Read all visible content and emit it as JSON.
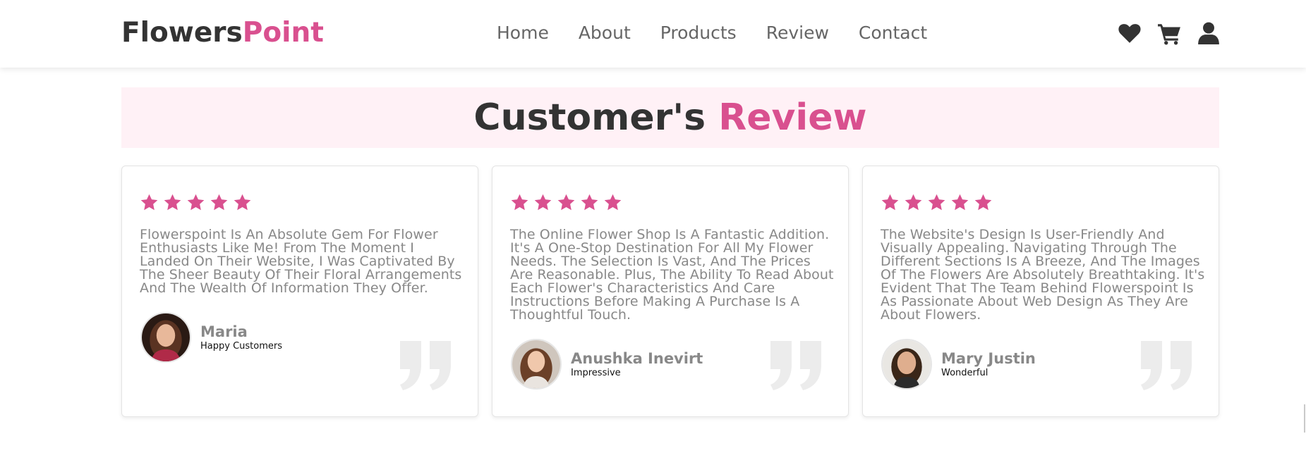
{
  "header": {
    "logo_primary": "Flowers",
    "logo_accent": "Point",
    "nav": [
      "Home",
      "About",
      "Products",
      "Review",
      "Contact"
    ],
    "icons": [
      "heart-icon",
      "cart-icon",
      "user-icon"
    ]
  },
  "section": {
    "title_primary": "Customer's",
    "title_accent": "Review"
  },
  "colors": {
    "accent": "#d9508f",
    "heading_band": "#fff1f6",
    "text_dark": "#333333",
    "text_muted": "#888888"
  },
  "reviews": [
    {
      "rating": 5,
      "text": "Flowerspoint Is An Absolute Gem For Flower Enthusiasts Like Me! From The Moment I Landed On Their Website, I Was Captivated By The Sheer Beauty Of Their Floral Arrangements And The Wealth Of Information They Offer.",
      "name": "Maria",
      "role": "Happy Customers"
    },
    {
      "rating": 5,
      "text": "The Online Flower Shop Is A Fantastic Addition. It's A One-Stop Destination For All My Flower Needs. The Selection Is Vast, And The Prices Are Reasonable. Plus, The Ability To Read About Each Flower's Characteristics And Care Instructions Before Making A Purchase Is A Thoughtful Touch.",
      "name": "Anushka Inevirt",
      "role": "Impressive"
    },
    {
      "rating": 5,
      "text": "The Website's Design Is User-Friendly And Visually Appealing. Navigating Through The Different Sections Is A Breeze, And The Images Of The Flowers Are Absolutely Breathtaking. It's Evident That The Team Behind Flowerspoint Is As Passionate About Web Design As They Are About Flowers.",
      "name": "Mary Justin",
      "role": "Wonderful"
    }
  ]
}
